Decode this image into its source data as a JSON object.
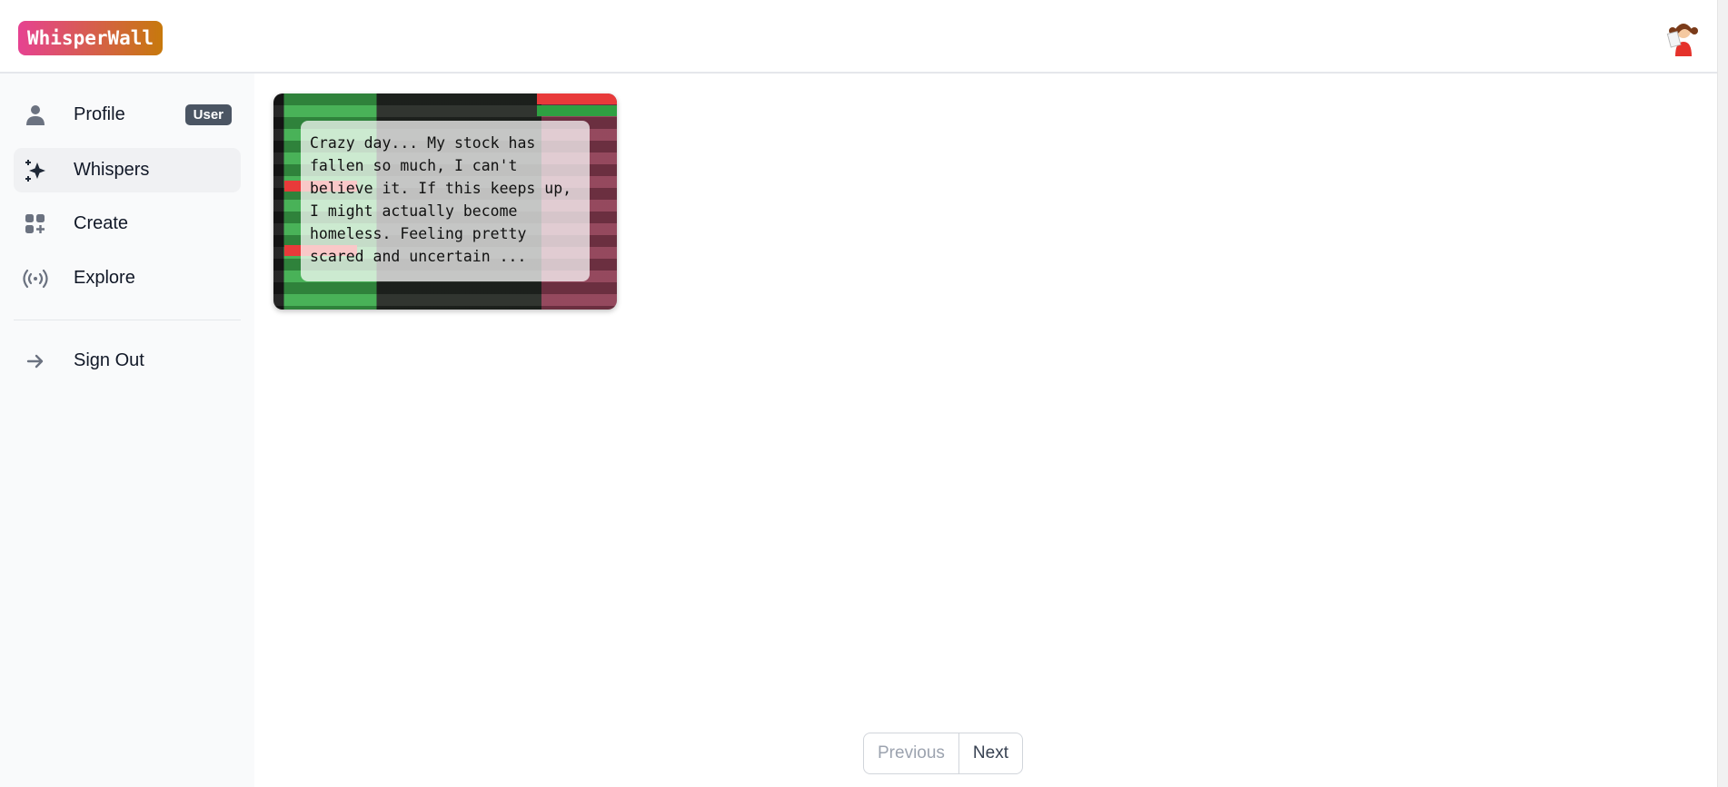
{
  "header": {
    "logo": "WhisperWall",
    "avatar_icon": "girl-avatar"
  },
  "sidebar": {
    "items": [
      {
        "label": "Profile",
        "icon": "user-icon",
        "badge": "User"
      },
      {
        "label": "Whispers",
        "icon": "sparkles-icon",
        "active": true
      },
      {
        "label": "Create",
        "icon": "squares-plus-icon"
      },
      {
        "label": "Explore",
        "icon": "signal-icon"
      },
      {
        "label": "Sign Out",
        "icon": "arrow-right-icon"
      }
    ]
  },
  "whispers": [
    {
      "text": "Crazy day... My stock has fallen so much, I can't believe it. If this keeps up, I might actually become homeless. Feeling pretty scared and uncertain ...",
      "background": "stock-ticker-image"
    }
  ],
  "pagination": {
    "previous": "Previous",
    "next": "Next"
  },
  "colors": {
    "logo_start": "#e64291",
    "logo_end": "#c7790c",
    "badge": "#4b5563"
  }
}
